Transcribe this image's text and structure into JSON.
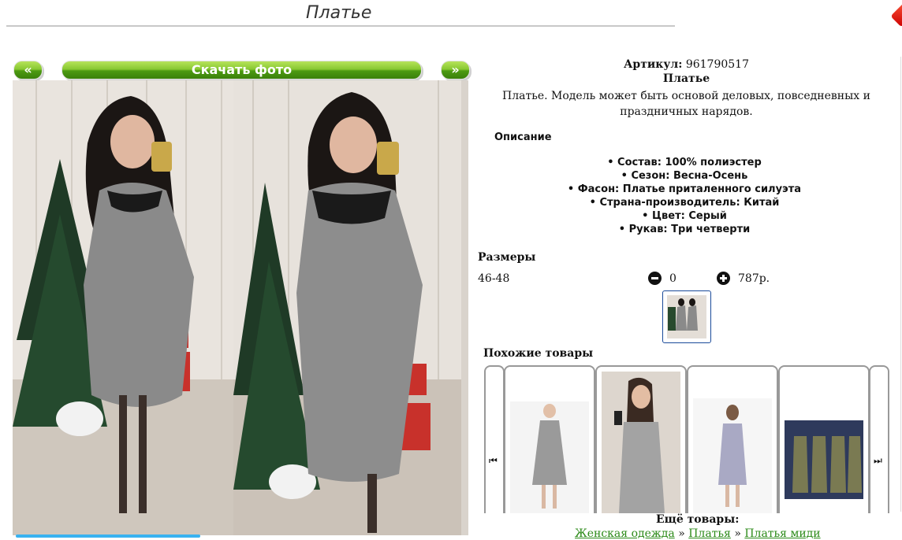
{
  "page": {
    "title": "Платье"
  },
  "gallery": {
    "prev_label": "«",
    "download_label": "Скачать фото",
    "next_label": "»"
  },
  "product": {
    "article_label": "Артикул:",
    "article_value": "961790517",
    "name": "Платье",
    "description": "Платье. Модель может быть основой деловых, повседневных и праздничных нарядов.",
    "description_heading": "Описание",
    "specs": [
      "Состав: 100% полиэстер",
      "Сезон: Весна-Осень",
      "Фасон: Платье приталенного силуэта",
      "Страна-производитель: Китай",
      "Цвет: Серый",
      "Рукав: Три четверти"
    ],
    "sizes_heading": "Размеры",
    "size": "46-48",
    "quantity": "0",
    "price": "787р."
  },
  "similar": {
    "heading": "Похожие товары",
    "left_arrow": "⏮",
    "right_arrow": "⏭"
  },
  "more": {
    "heading": "Ещё товары:",
    "crumbs": [
      "Женская одежда",
      "Платья",
      "Платья миди"
    ],
    "separator": " » "
  },
  "colors": {
    "accent_green": "#5aa81e",
    "link_green": "#2b8a18",
    "thumb_border": "#1a4a9a"
  }
}
